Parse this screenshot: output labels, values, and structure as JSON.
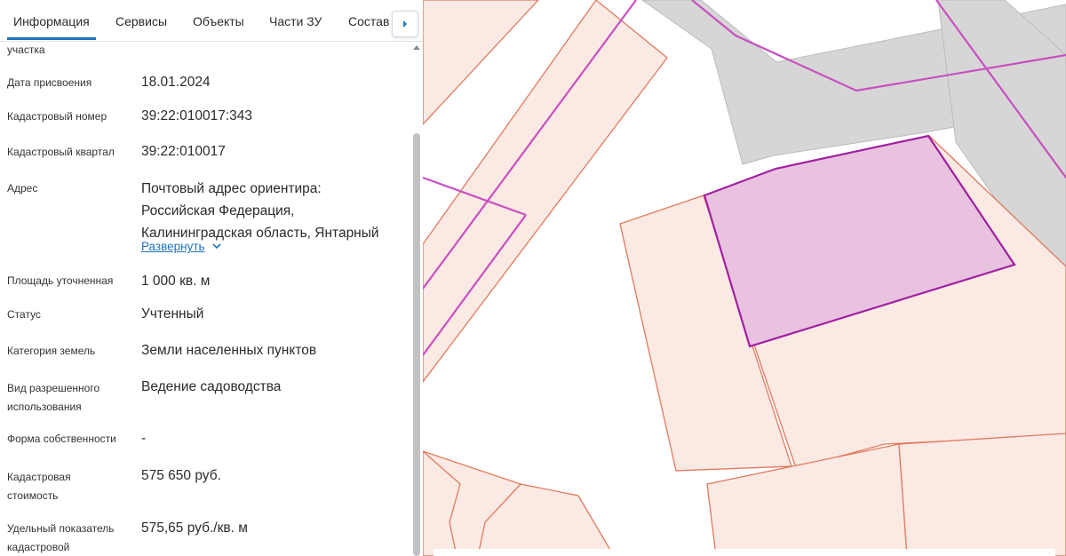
{
  "tabs": [
    {
      "label": "Информация"
    },
    {
      "label": "Сервисы"
    },
    {
      "label": "Объекты"
    },
    {
      "label": "Части ЗУ"
    },
    {
      "label": "Состав"
    }
  ],
  "info": {
    "cut_label": "участка",
    "date_label": "Дата присвоения",
    "date_value": "18.01.2024",
    "cadnum_label": "Кадастровый номер",
    "cadnum_value": "39:22:010017:343",
    "quarter_label": "Кадастровый квартал",
    "quarter_value": "39:22:010017",
    "address_label": "Адрес",
    "address_lines": [
      "Почтовый адрес ориентира:",
      "Российская Федерация,",
      "Калининградская область, Янтарный"
    ],
    "expand_label": "Развернуть",
    "area_label": "Площадь уточненная",
    "area_value": "1 000 кв. м",
    "status_label": "Статус",
    "status_value": "Учтенный",
    "category_label": "Категория земель",
    "category_value": "Земли населенных пунктов",
    "use_label_lines": [
      "Вид разрешенного",
      "использования"
    ],
    "use_value": "Ведение садоводства",
    "ownership_label": "Форма собственности",
    "ownership_value": "-",
    "cost_label_lines": [
      "Кадастровая",
      "стоимость"
    ],
    "cost_value": "575 650 руб.",
    "specific_label_lines": [
      "Удельный показатель",
      "кадастровой"
    ],
    "specific_value": "575,65 руб./кв. м"
  },
  "icons": {
    "next": "chevron-right-icon",
    "expand": "chevron-down-icon",
    "scroll_up": "arrow-up-icon"
  },
  "colors": {
    "accent": "#1e73be",
    "parcel_fill": "#fbe9e4",
    "parcel_stroke": "#e07a5f",
    "selected_fill": "#e8c2df",
    "selected_stroke": "#a020a0",
    "road_fill": "#d6d6d6",
    "boundary_line": "#c850c0"
  }
}
